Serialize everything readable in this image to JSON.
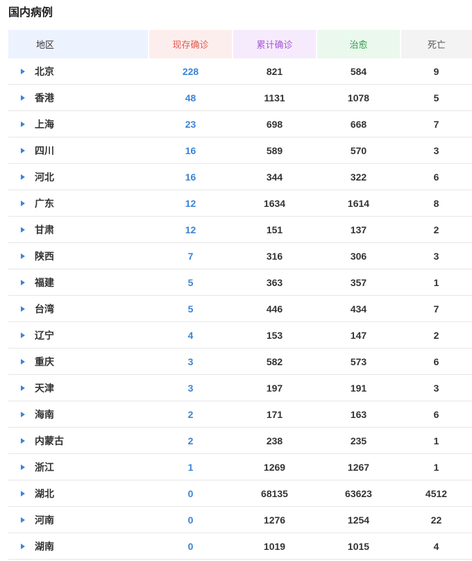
{
  "title": "国内病例",
  "headers": {
    "region": "地区",
    "current": "现存确诊",
    "total": "累计确诊",
    "cured": "治愈",
    "dead": "死亡"
  },
  "rows": [
    {
      "region": "北京",
      "current": "228",
      "total": "821",
      "cured": "584",
      "dead": "9"
    },
    {
      "region": "香港",
      "current": "48",
      "total": "1131",
      "cured": "1078",
      "dead": "5"
    },
    {
      "region": "上海",
      "current": "23",
      "total": "698",
      "cured": "668",
      "dead": "7"
    },
    {
      "region": "四川",
      "current": "16",
      "total": "589",
      "cured": "570",
      "dead": "3"
    },
    {
      "region": "河北",
      "current": "16",
      "total": "344",
      "cured": "322",
      "dead": "6"
    },
    {
      "region": "广东",
      "current": "12",
      "total": "1634",
      "cured": "1614",
      "dead": "8"
    },
    {
      "region": "甘肃",
      "current": "12",
      "total": "151",
      "cured": "137",
      "dead": "2"
    },
    {
      "region": "陕西",
      "current": "7",
      "total": "316",
      "cured": "306",
      "dead": "3"
    },
    {
      "region": "福建",
      "current": "5",
      "total": "363",
      "cured": "357",
      "dead": "1"
    },
    {
      "region": "台湾",
      "current": "5",
      "total": "446",
      "cured": "434",
      "dead": "7"
    },
    {
      "region": "辽宁",
      "current": "4",
      "total": "153",
      "cured": "147",
      "dead": "2"
    },
    {
      "region": "重庆",
      "current": "3",
      "total": "582",
      "cured": "573",
      "dead": "6"
    },
    {
      "region": "天津",
      "current": "3",
      "total": "197",
      "cured": "191",
      "dead": "3"
    },
    {
      "region": "海南",
      "current": "2",
      "total": "171",
      "cured": "163",
      "dead": "6"
    },
    {
      "region": "内蒙古",
      "current": "2",
      "total": "238",
      "cured": "235",
      "dead": "1"
    },
    {
      "region": "浙江",
      "current": "1",
      "total": "1269",
      "cured": "1267",
      "dead": "1"
    },
    {
      "region": "湖北",
      "current": "0",
      "total": "68135",
      "cured": "63623",
      "dead": "4512"
    },
    {
      "region": "河南",
      "current": "0",
      "total": "1276",
      "cured": "1254",
      "dead": "22"
    },
    {
      "region": "湖南",
      "current": "0",
      "total": "1019",
      "cured": "1015",
      "dead": "4"
    }
  ],
  "colors": {
    "current_text": "#3b84d6",
    "expand_arrow": "#3b84d6",
    "header_region_bg": "#edf2ff",
    "header_current_bg": "#fdeeee",
    "header_total_bg": "#f6ebfc",
    "header_cured_bg": "#eaf8ee",
    "header_dead_bg": "#f3f3f3"
  },
  "icons": {
    "row_expand": "caret-right-icon"
  }
}
